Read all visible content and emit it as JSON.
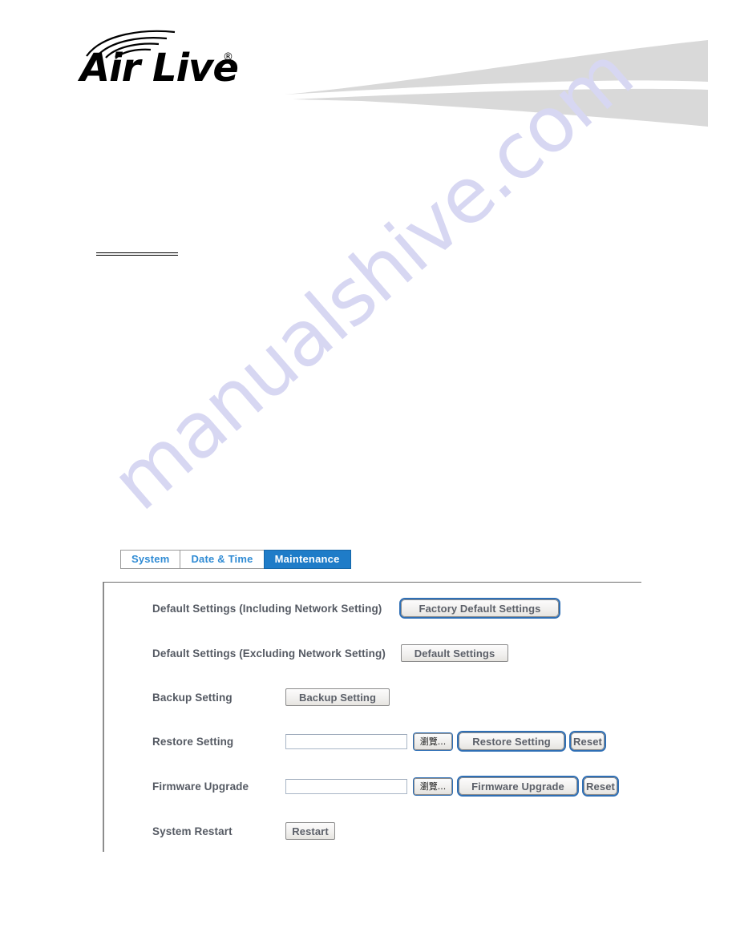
{
  "brand": {
    "logo_text": "Air Live",
    "registered_mark": "®",
    "logo_icon": "wifi-arcs-icon"
  },
  "tabs": [
    {
      "label": "System",
      "active": false
    },
    {
      "label": "Date & Time",
      "active": false
    },
    {
      "label": "Maintenance",
      "active": true
    }
  ],
  "panel": {
    "rows": [
      {
        "label": "Default Settings (Including Network Setting)",
        "button": "Factory Default Settings"
      },
      {
        "label": "Default Settings (Excluding Network Setting)",
        "button": "Default Settings"
      },
      {
        "label": "Backup Setting",
        "button": "Backup Setting"
      },
      {
        "label": "Restore Setting",
        "file_value": "",
        "browse": "瀏覽...",
        "button": "Restore Setting",
        "reset": "Reset"
      },
      {
        "label": "Firmware Upgrade",
        "file_value": "",
        "browse": "瀏覽...",
        "button": "Firmware Upgrade",
        "reset": "Reset"
      },
      {
        "label": "System Restart",
        "button": "Restart"
      }
    ]
  },
  "watermark": {
    "text": "manualshive.com"
  },
  "colors": {
    "tab_active_bg": "#1f7cc8",
    "tab_text": "#2f8bd4",
    "label_text": "#555a63",
    "swoosh": "#d9d9d9",
    "watermark": "#d7d7f2",
    "focus_ring": "#2f6fb5"
  }
}
